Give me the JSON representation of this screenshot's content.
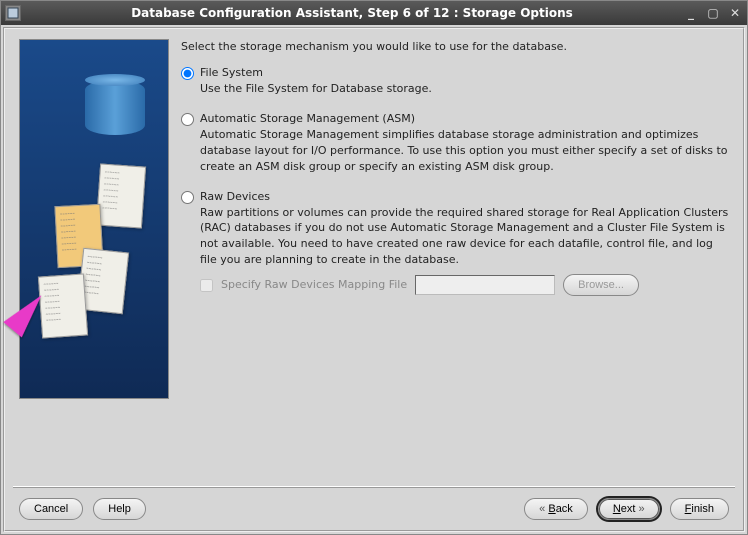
{
  "window": {
    "title": "Database Configuration Assistant, Step 6 of 12 : Storage Options"
  },
  "main": {
    "prompt": "Select the storage mechanism you would like to use for the database.",
    "options": [
      {
        "id": "file-system",
        "label": "File System",
        "desc": "Use the File System for Database storage.",
        "selected": true
      },
      {
        "id": "asm",
        "label": "Automatic Storage Management (ASM)",
        "desc": "Automatic Storage Management simplifies database storage administration and optimizes database layout for I/O performance. To use this option you must either specify a set of disks to create an ASM disk group or specify an existing ASM disk group.",
        "selected": false
      },
      {
        "id": "raw",
        "label": "Raw Devices",
        "desc": "Raw partitions or volumes can provide the required shared storage for Real Application Clusters (RAC) databases if you do not use Automatic Storage Management and a Cluster File System is not available.  You need to have created one raw device for each datafile, control file, and log file you are planning to create in the database.",
        "selected": false
      }
    ],
    "mapping": {
      "checkbox_label": "Specify Raw Devices Mapping File",
      "value": "",
      "browse_label": "Browse...",
      "enabled": false
    }
  },
  "footer": {
    "cancel": "Cancel",
    "help": "Help",
    "back": "Back",
    "next": "Next",
    "finish": "Finish"
  }
}
